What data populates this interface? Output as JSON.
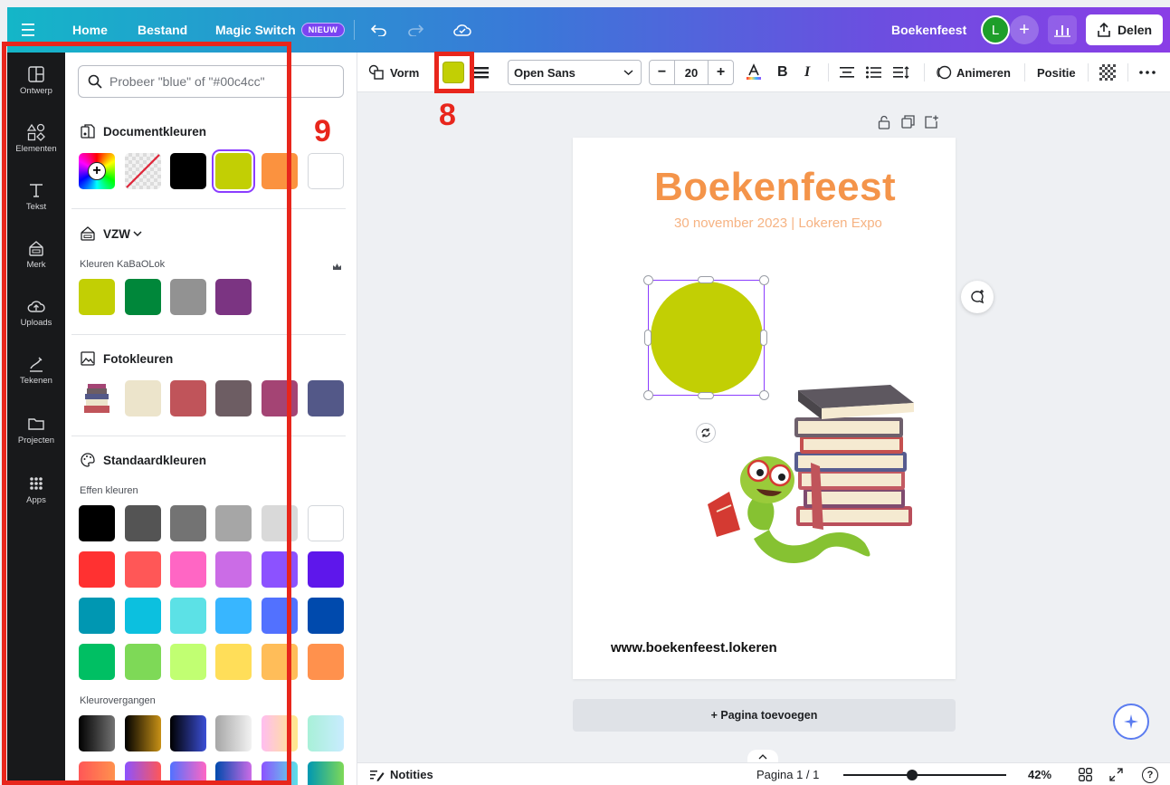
{
  "topbar": {
    "home": "Home",
    "file": "Bestand",
    "magic_switch": "Magic Switch",
    "new_badge": "NIEUW",
    "doc_title": "Boekenfeest",
    "avatar_initial": "L",
    "share": "Delen"
  },
  "rail": {
    "items": [
      {
        "label": "Ontwerp"
      },
      {
        "label": "Elementen"
      },
      {
        "label": "Tekst"
      },
      {
        "label": "Merk"
      },
      {
        "label": "Uploads"
      },
      {
        "label": "Tekenen"
      },
      {
        "label": "Projecten"
      },
      {
        "label": "Apps"
      }
    ]
  },
  "panel": {
    "search_placeholder": "Probeer \"blue\" of \"#00c4cc\"",
    "doc_colors_title": "Documentkleuren",
    "doc_colors": [
      "#000000",
      "#c2cf04",
      "#fb923f",
      "#ffffff"
    ],
    "brand_title": "VZW",
    "brand_sub": "Kleuren KaBaOLok",
    "brand_colors": [
      "#c2cf04",
      "#00873a",
      "#929292",
      "#7b3482"
    ],
    "photo_title": "Fotokleuren",
    "photo_colors": [
      "#ece4cb",
      "#c0545a",
      "#6d5d63",
      "#a44474",
      "#535888"
    ],
    "default_title": "Standaardkleuren",
    "solid_label": "Effen kleuren",
    "solid_colors": [
      [
        "#000000",
        "#545454",
        "#737373",
        "#a6a6a6",
        "#d9d9d9",
        "#ffffff"
      ],
      [
        "#ff3131",
        "#ff5757",
        "#ff66c4",
        "#cb6ce6",
        "#8c52ff",
        "#5e17eb"
      ],
      [
        "#0097b2",
        "#0cc0df",
        "#5ce1e6",
        "#38b6ff",
        "#5271ff",
        "#004aad"
      ],
      [
        "#00bf63",
        "#7ed957",
        "#c1ff72",
        "#ffde59",
        "#ffbd59",
        "#ff914d"
      ]
    ],
    "gradient_label": "Kleurovergangen"
  },
  "annotations": {
    "label_8": "8",
    "label_9": "9",
    "accent": "#e8261c"
  },
  "toolbar": {
    "shape": "Vorm",
    "selected_color": "#c2cf04",
    "font": "Open Sans",
    "font_size": "20",
    "animate": "Animeren",
    "position": "Positie"
  },
  "canvas": {
    "title": "Boekenfeest",
    "subtitle": "30 november 2023 | Lokeren Expo",
    "url": "www.boekenfeest.lokeren",
    "add_page": "+ Pagina toevoegen"
  },
  "bottom": {
    "notes": "Notities",
    "page_indicator": "Pagina 1 / 1",
    "zoom": "42%",
    "zoom_level": 0.42
  }
}
